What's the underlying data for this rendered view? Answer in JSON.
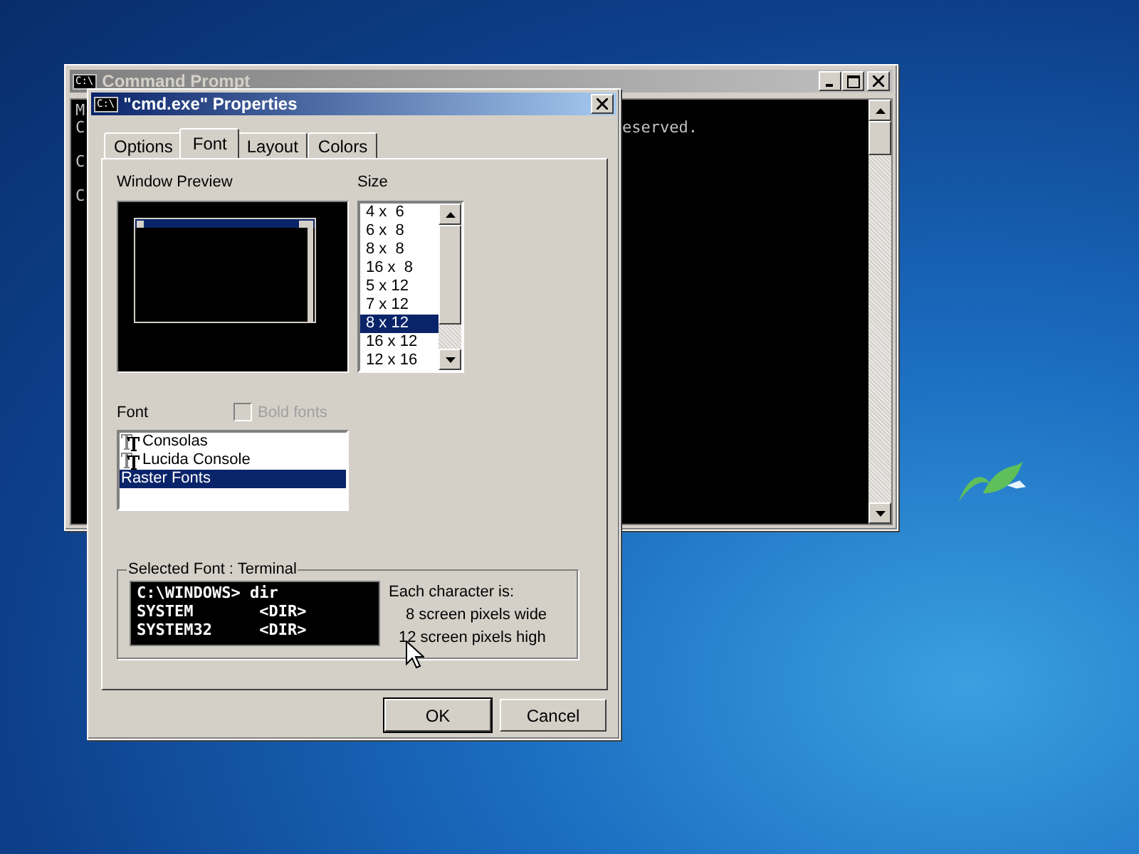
{
  "console_window": {
    "icon_label": "C:\\",
    "title": "Command Prompt",
    "active": false,
    "lines": [
      {
        "left": "M"
      },
      {
        "left": "C",
        "right": "eserved."
      },
      {
        "left": "C"
      },
      {
        "left": "C"
      }
    ]
  },
  "dialog": {
    "icon_label": "C:\\",
    "title": "\"cmd.exe\" Properties",
    "active": true,
    "tabs": [
      {
        "label": "Options",
        "selected": false
      },
      {
        "label": "Font",
        "selected": true
      },
      {
        "label": "Layout",
        "selected": false
      },
      {
        "label": "Colors",
        "selected": false
      }
    ],
    "window_preview": {
      "label": "Window Preview"
    },
    "size": {
      "label": "Size",
      "items": [
        {
          "label": "4 x  6",
          "selected": false
        },
        {
          "label": "6 x  8",
          "selected": false
        },
        {
          "label": "8 x  8",
          "selected": false
        },
        {
          "label": "16 x  8",
          "selected": false
        },
        {
          "label": "5 x 12",
          "selected": false
        },
        {
          "label": "7 x 12",
          "selected": false
        },
        {
          "label": "8 x 12",
          "selected": true
        },
        {
          "label": "16 x 12",
          "selected": false
        },
        {
          "label": "12 x 16",
          "selected": false
        }
      ]
    },
    "font": {
      "label": "Font",
      "bold_fonts": {
        "label": "Bold fonts",
        "checked": false,
        "disabled": true
      },
      "items": [
        {
          "label": "Consolas",
          "truetype": true,
          "selected": false
        },
        {
          "label": "Lucida Console",
          "truetype": true,
          "selected": false
        },
        {
          "label": "Raster Fonts",
          "truetype": false,
          "selected": true
        }
      ]
    },
    "selected_font": {
      "label": "Selected Font : Terminal",
      "preview_lines": [
        "C:\\WINDOWS> dir",
        "SYSTEM       <DIR>",
        "SYSTEM32     <DIR>"
      ],
      "info": [
        "Each character is:",
        "8 screen pixels wide",
        "12 screen pixels high"
      ]
    },
    "buttons": [
      {
        "label": "OK",
        "default": true
      },
      {
        "label": "Cancel",
        "default": false
      }
    ]
  }
}
